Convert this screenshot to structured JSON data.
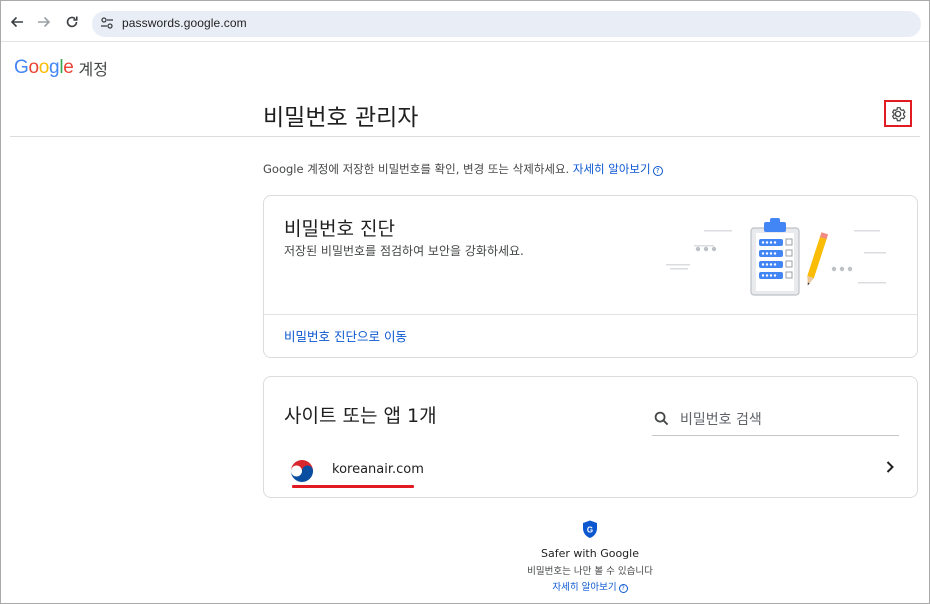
{
  "browser": {
    "url": "passwords.google.com"
  },
  "header": {
    "logo": [
      {
        "ch": "G",
        "color": "#4285F4"
      },
      {
        "ch": "o",
        "color": "#EA4335"
      },
      {
        "ch": "o",
        "color": "#FBBC05"
      },
      {
        "ch": "g",
        "color": "#4285F4"
      },
      {
        "ch": "l",
        "color": "#34A853"
      },
      {
        "ch": "e",
        "color": "#EA4335"
      }
    ],
    "account_label": "계정"
  },
  "page": {
    "title": "비밀번호 관리자",
    "intro_text": "Google 계정에 저장한 비밀번호를 확인, 변경 또는 삭제하세요. ",
    "intro_link": "자세히 알아보기"
  },
  "checkup": {
    "title": "비밀번호 진단",
    "subtitle": "저장된 비밀번호를 점검하여 보안을 강화하세요.",
    "link": "비밀번호 진단으로 이동"
  },
  "sites": {
    "title": "사이트 또는 앱 1개",
    "search_placeholder": "비밀번호 검색",
    "items": [
      {
        "name": "koreanair.com"
      }
    ]
  },
  "footer": {
    "title": "Safer with Google",
    "subtitle": "비밀번호는 나만 볼 수 있습니다",
    "link": "자세히 알아보기"
  },
  "colors": {
    "link": "#0b57d0",
    "highlight_red": "#e21b23",
    "omnibox_bg": "#e9eef6"
  }
}
